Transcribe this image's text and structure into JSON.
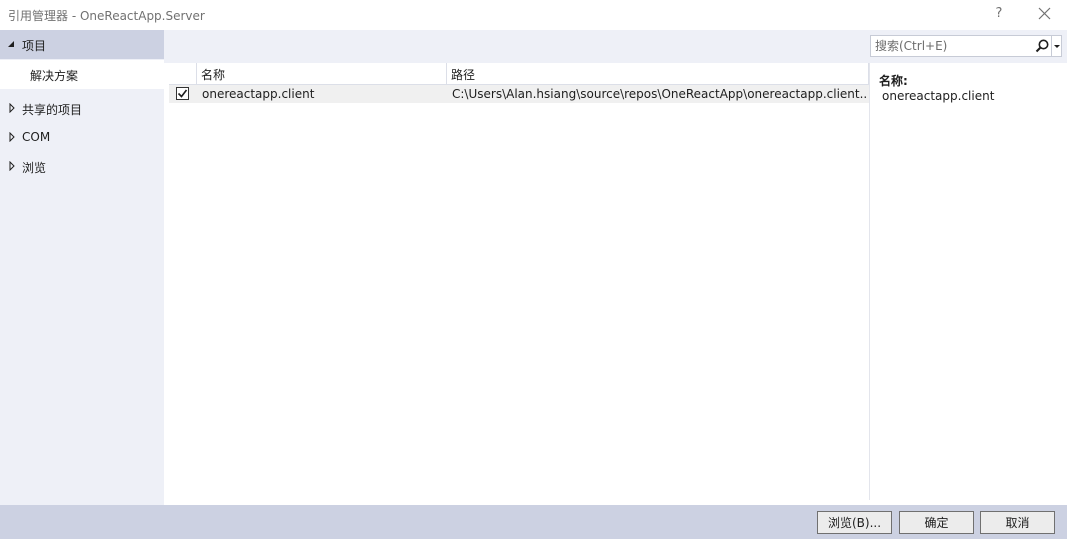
{
  "window": {
    "title": "引用管理器 - OneReactApp.Server",
    "help_label": "?"
  },
  "nav": {
    "items": [
      {
        "label": "项目",
        "expanded": true,
        "selected": true
      },
      {
        "label": "解决方案",
        "child": true
      },
      {
        "label": "共享的项目",
        "expanded": false
      },
      {
        "label": "COM",
        "expanded": false
      },
      {
        "label": "浏览",
        "expanded": false
      }
    ]
  },
  "search": {
    "placeholder": "搜索(Ctrl+E)",
    "value": ""
  },
  "grid": {
    "columns": [
      "名称",
      "路径"
    ],
    "rows": [
      {
        "checked": true,
        "name": "onereactapp.client",
        "path": "C:\\Users\\Alan.hsiang\\source\\repos\\OneReactApp\\onereactapp.client..."
      }
    ]
  },
  "details": {
    "name_label": "名称:",
    "name_value": "onereactapp.client"
  },
  "buttons": {
    "browse": "浏览(B)...",
    "ok": "确定",
    "cancel": "取消"
  },
  "colors": {
    "nav_bg": "#eef0f7",
    "nav_selected": "#ccd1e2",
    "bottom_bar": "#ccd1e2",
    "button_bg": "#ececec"
  }
}
